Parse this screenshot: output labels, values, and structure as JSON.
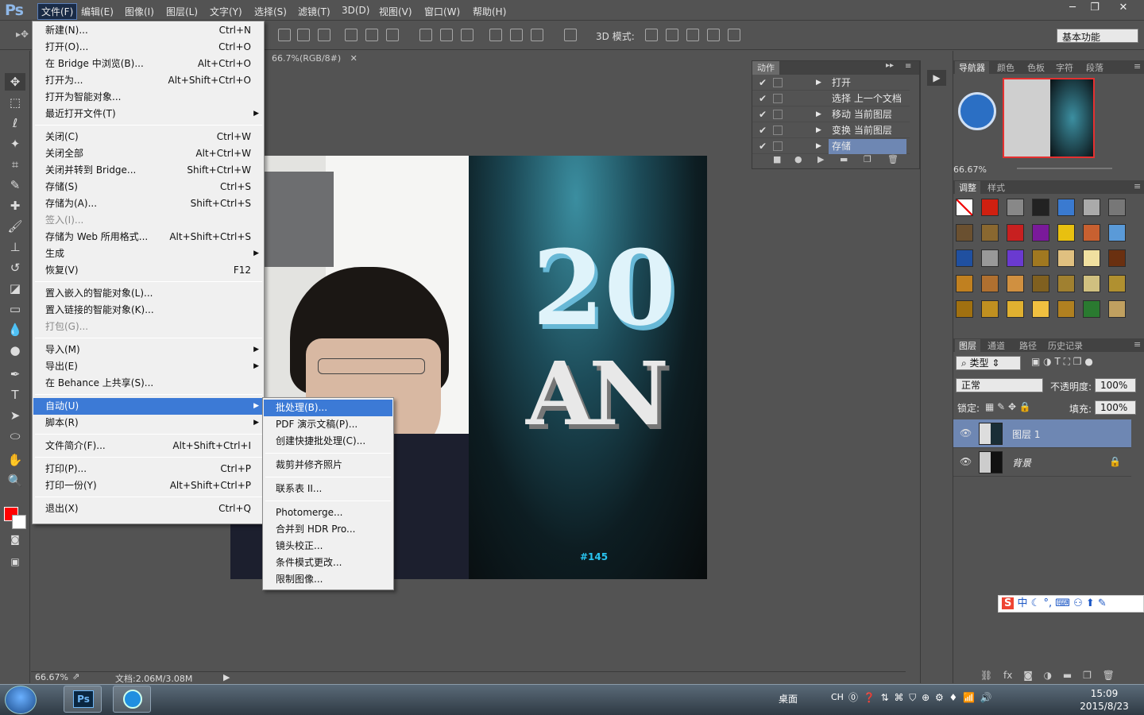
{
  "app": {
    "logo": "Ps",
    "workspace": "基本功能"
  },
  "menubar": [
    "文件(F)",
    "编辑(E)",
    "图像(I)",
    "图层(L)",
    "文字(Y)",
    "选择(S)",
    "滤镜(T)",
    "3D(D)",
    "视图(V)",
    "窗口(W)",
    "帮助(H)"
  ],
  "window_controls": [
    "─",
    "❐",
    "✕"
  ],
  "options": {
    "mode_label": "3D 模式:"
  },
  "document": {
    "tab": "66.7%(RGB/8#)",
    "zoom": "66.67%",
    "docsize": "文档:2.06M/3.08M"
  },
  "file_menu": [
    {
      "label": "新建(N)...",
      "shortcut": "Ctrl+N"
    },
    {
      "label": "打开(O)...",
      "shortcut": "Ctrl+O"
    },
    {
      "label": "在 Bridge 中浏览(B)...",
      "shortcut": "Alt+Ctrl+O"
    },
    {
      "label": "打开为...",
      "shortcut": "Alt+Shift+Ctrl+O"
    },
    {
      "label": "打开为智能对象...",
      "shortcut": ""
    },
    {
      "label": "最近打开文件(T)",
      "shortcut": "",
      "submenu": true
    },
    {
      "sep": true
    },
    {
      "label": "关闭(C)",
      "shortcut": "Ctrl+W"
    },
    {
      "label": "关闭全部",
      "shortcut": "Alt+Ctrl+W"
    },
    {
      "label": "关闭并转到 Bridge...",
      "shortcut": "Shift+Ctrl+W"
    },
    {
      "label": "存储(S)",
      "shortcut": "Ctrl+S"
    },
    {
      "label": "存储为(A)...",
      "shortcut": "Shift+Ctrl+S"
    },
    {
      "label": "签入(I)...",
      "shortcut": "",
      "disabled": true
    },
    {
      "label": "存储为 Web 所用格式...",
      "shortcut": "Alt+Shift+Ctrl+S"
    },
    {
      "label": "生成",
      "shortcut": "",
      "submenu": true
    },
    {
      "label": "恢复(V)",
      "shortcut": "F12"
    },
    {
      "sep": true
    },
    {
      "label": "置入嵌入的智能对象(L)...",
      "shortcut": ""
    },
    {
      "label": "置入链接的智能对象(K)...",
      "shortcut": ""
    },
    {
      "label": "打包(G)...",
      "shortcut": "",
      "disabled": true
    },
    {
      "sep": true
    },
    {
      "label": "导入(M)",
      "shortcut": "",
      "submenu": true
    },
    {
      "label": "导出(E)",
      "shortcut": "",
      "submenu": true
    },
    {
      "label": "在 Behance 上共享(S)...",
      "shortcut": ""
    },
    {
      "sep": true
    },
    {
      "label": "自动(U)",
      "shortcut": "",
      "submenu": true,
      "highlight": true
    },
    {
      "label": "脚本(R)",
      "shortcut": "",
      "submenu": true
    },
    {
      "sep": true
    },
    {
      "label": "文件简介(F)...",
      "shortcut": "Alt+Shift+Ctrl+I"
    },
    {
      "sep": true
    },
    {
      "label": "打印(P)...",
      "shortcut": "Ctrl+P"
    },
    {
      "label": "打印一份(Y)",
      "shortcut": "Alt+Shift+Ctrl+P"
    },
    {
      "sep": true
    },
    {
      "label": "退出(X)",
      "shortcut": "Ctrl+Q"
    }
  ],
  "auto_submenu": [
    {
      "label": "批处理(B)...",
      "highlight": true
    },
    {
      "label": "PDF 演示文稿(P)..."
    },
    {
      "label": "创建快捷批处理(C)..."
    },
    {
      "sep": true
    },
    {
      "label": "裁剪并修齐照片"
    },
    {
      "sep": true
    },
    {
      "label": "联系表 II..."
    },
    {
      "sep": true
    },
    {
      "label": "Photomerge..."
    },
    {
      "label": "合并到 HDR Pro..."
    },
    {
      "label": "镜头校正..."
    },
    {
      "label": "条件模式更改..."
    },
    {
      "label": "限制图像..."
    }
  ],
  "actions_panel": {
    "title": "动作",
    "rows": [
      {
        "label": "打开",
        "expand": true
      },
      {
        "label": "选择 上一个文档",
        "expand": false
      },
      {
        "label": "移动 当前图层",
        "expand": true
      },
      {
        "label": "变换 当前图层",
        "expand": true
      },
      {
        "label": "存储",
        "expand": true,
        "selected": true
      }
    ]
  },
  "navigator": {
    "tabs": [
      "导航器",
      "颜色",
      "色板",
      "字符",
      "段落"
    ],
    "zoom": "66.67%"
  },
  "styles": {
    "tabs": [
      "调整",
      "样式"
    ]
  },
  "layers": {
    "tabs": [
      "图层",
      "通道",
      "路径",
      "历史记录"
    ],
    "kind": "类型",
    "blend": "正常",
    "opacity_label": "不透明度:",
    "opacity": "100%",
    "lock_label": "锁定:",
    "fill_label": "填充:",
    "fill": "100%",
    "items": [
      {
        "name": "图层 1",
        "selected": true
      },
      {
        "name": "背景",
        "locked": true
      }
    ]
  },
  "poster": {
    "big": "20",
    "an": "AN",
    "tag": "#145"
  },
  "ime": "中",
  "taskbar": {
    "desktop": "桌面",
    "lang": "CH",
    "time": "15:09",
    "date": "2015/8/23"
  }
}
